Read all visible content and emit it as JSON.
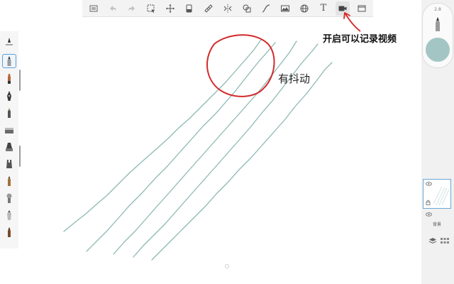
{
  "toolbar": {
    "items": [
      {
        "icon": "gallery-icon"
      },
      {
        "icon": "undo-icon",
        "disabled": true
      },
      {
        "icon": "redo-icon",
        "disabled": true
      },
      {
        "icon": "selection-icon"
      },
      {
        "icon": "transform-icon"
      },
      {
        "icon": "fill-icon"
      },
      {
        "icon": "ruler-icon"
      },
      {
        "icon": "symmetry-icon"
      },
      {
        "icon": "shapes-icon"
      },
      {
        "icon": "curve-icon"
      },
      {
        "icon": "image-icon"
      },
      {
        "icon": "perspective-guide-icon"
      },
      {
        "icon": "text-icon",
        "text": "T"
      },
      {
        "icon": "record-video-icon",
        "active": true
      },
      {
        "icon": "fullscreen-icon"
      }
    ]
  },
  "brushes": [
    "pencil-icon",
    "marker-icon",
    "ink-pen-icon",
    "fountain-pen-icon",
    "airbrush-icon",
    "paint-brush-icon",
    "flat-brush-icon",
    "calligraphy-icon",
    "smudge-icon",
    "eraser-icon",
    "soft-eraser-icon",
    "blender-icon"
  ],
  "puck": {
    "size_label": "2.8",
    "color": "#a3c6c4"
  },
  "layers": {
    "background_label": "背景"
  },
  "annotations": {
    "jitter_note": "有抖动",
    "record_note": "开启可以记录视频"
  },
  "colors": {
    "stroke": "#8db9b4",
    "annotation_red": "#d42a2a"
  }
}
